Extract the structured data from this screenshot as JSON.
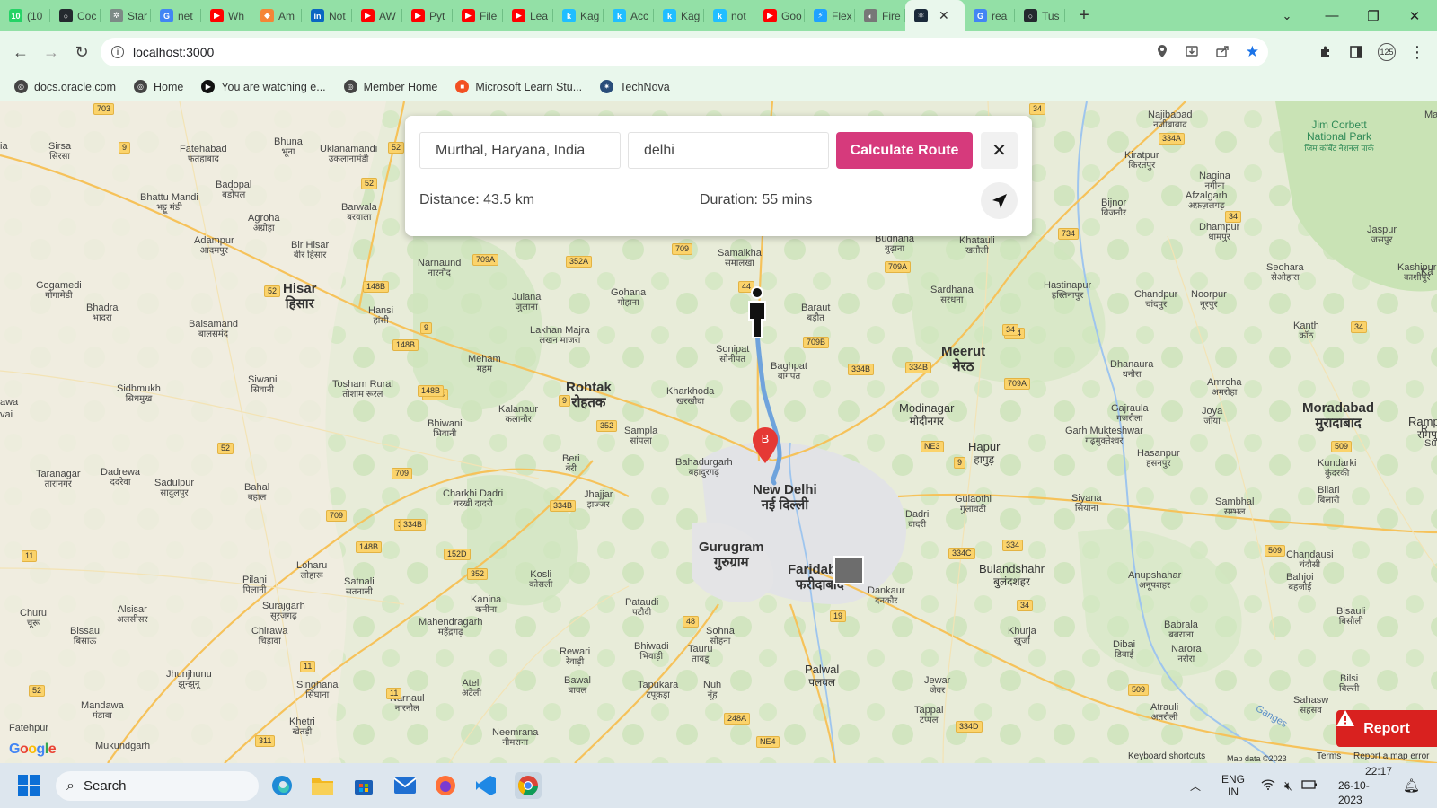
{
  "browser": {
    "tabs": [
      {
        "label": "(10",
        "icon": "whatsapp-icon",
        "color": "#25d366",
        "glyph": "10"
      },
      {
        "label": "Coc",
        "icon": "github-icon",
        "color": "#24292e",
        "glyph": "○"
      },
      {
        "label": "Star",
        "icon": "openai-icon",
        "color": "#7d8a86",
        "glyph": "✲"
      },
      {
        "label": "net",
        "icon": "google-icon",
        "color": "#4285f4",
        "glyph": "G"
      },
      {
        "label": "Wh",
        "icon": "youtube-icon",
        "color": "#ff0000",
        "glyph": "▶"
      },
      {
        "label": "Am",
        "icon": "aws-icon",
        "color": "#f58536",
        "glyph": "◆"
      },
      {
        "label": "Not",
        "icon": "linkedin-icon",
        "color": "#0a66c2",
        "glyph": "in"
      },
      {
        "label": "AW",
        "icon": "youtube-icon",
        "color": "#ff0000",
        "glyph": "▶"
      },
      {
        "label": "Pyt",
        "icon": "youtube-icon",
        "color": "#ff0000",
        "glyph": "▶"
      },
      {
        "label": "File",
        "icon": "youtube-icon",
        "color": "#ff0000",
        "glyph": "▶"
      },
      {
        "label": "Lea",
        "icon": "youtube-icon",
        "color": "#ff0000",
        "glyph": "▶"
      },
      {
        "label": "Kag",
        "icon": "kaggle-icon",
        "color": "#20beff",
        "glyph": "k"
      },
      {
        "label": "Acc",
        "icon": "kaggle-icon",
        "color": "#20beff",
        "glyph": "k"
      },
      {
        "label": "Kag",
        "icon": "kaggle-icon",
        "color": "#20beff",
        "glyph": "k"
      },
      {
        "label": "not",
        "icon": "kaggle-icon",
        "color": "#20beff",
        "glyph": "k"
      },
      {
        "label": "Goo",
        "icon": "youtube-icon",
        "color": "#ff0000",
        "glyph": "▶"
      },
      {
        "label": "Flex",
        "icon": "bolt-icon",
        "color": "#1fa2ff",
        "glyph": "⚡"
      },
      {
        "label": "Fire",
        "icon": "globe-icon",
        "color": "#777777",
        "glyph": "◐"
      },
      {
        "label": "",
        "icon": "react-icon",
        "color": "#1b2a3a",
        "glyph": "⚛",
        "active": true
      },
      {
        "label": "rea",
        "icon": "google-icon",
        "color": "#4285f4",
        "glyph": "G"
      },
      {
        "label": "Tus",
        "icon": "github-icon",
        "color": "#24292e",
        "glyph": "○"
      }
    ],
    "url": "localhost:3000",
    "bookmarks": [
      {
        "label": "docs.oracle.com",
        "icon": "globe-icon"
      },
      {
        "label": "Home",
        "icon": "globe-icon"
      },
      {
        "label": "You are watching e...",
        "icon": "play-icon"
      },
      {
        "label": "Member Home",
        "icon": "globe-icon"
      },
      {
        "label": "Microsoft Learn Stu...",
        "icon": "microsoft-icon"
      },
      {
        "label": "TechNova",
        "icon": "technova-icon"
      }
    ],
    "profile_badge": "125"
  },
  "route_panel": {
    "origin_value": "Murthal, Haryana, India",
    "destination_value": "delhi",
    "calculate_label": "Calculate Route",
    "close_label": "✕",
    "distance_text": "Distance: 43.5 km",
    "duration_text": "Duration: 55 mins"
  },
  "map": {
    "places": [
      {
        "en": "Sirsa",
        "hi": "सिरसा"
      },
      {
        "en": "Fatehabad",
        "hi": "फतेहाबाद"
      },
      {
        "en": "Bhuna",
        "hi": "भूना"
      },
      {
        "en": "Uklanamandi",
        "hi": "उकलानामंडी"
      },
      {
        "en": "Bhattu Mandi",
        "hi": "भट्टू मंडी"
      },
      {
        "en": "Badopal",
        "hi": "बडोपल"
      },
      {
        "en": "Barwala",
        "hi": "बरवाला"
      },
      {
        "en": "Agroha",
        "hi": "अग्रोहा"
      },
      {
        "en": "Adampur",
        "hi": "आदमपुर"
      },
      {
        "en": "Bir Hisar",
        "hi": "बीर हिसार"
      },
      {
        "en": "Narnaund",
        "hi": "नारनौंद"
      },
      {
        "en": "Gogamedi",
        "hi": "गोगामेडी"
      },
      {
        "en": "Bhadra",
        "hi": "भादरा"
      },
      {
        "en": "Hisar",
        "hi": "हिसार"
      },
      {
        "en": "Hansi",
        "hi": "हांसी"
      },
      {
        "en": "Balsamand",
        "hi": "बालसमंद"
      },
      {
        "en": "Julana",
        "hi": "जुलाना"
      },
      {
        "en": "Gohana",
        "hi": "गोहाना"
      },
      {
        "en": "Lakhan Majra",
        "hi": "लखन माजरा"
      },
      {
        "en": "Samalkha",
        "hi": "समालखा"
      },
      {
        "en": "Budhana",
        "hi": "बुढ़ाना"
      },
      {
        "en": "Khatauli",
        "hi": "खतौली"
      },
      {
        "en": "Meham",
        "hi": "महम"
      },
      {
        "en": "Sonipat",
        "hi": "सोनीपत"
      },
      {
        "en": "Baraut",
        "hi": "बड़ौत"
      },
      {
        "en": "Sardhana",
        "hi": "सरधना"
      },
      {
        "en": "Hastinapur",
        "hi": "हस्तिनापुर"
      },
      {
        "en": "Sidhmukh",
        "hi": "सिधमुख"
      },
      {
        "en": "Siwani",
        "hi": "सिवानी"
      },
      {
        "en": "Tosham Rural",
        "hi": "तोशाम रूरल"
      },
      {
        "en": "Rohtak",
        "hi": "रोहतक"
      },
      {
        "en": "Kharkhoda",
        "hi": "खरखौदा"
      },
      {
        "en": "Baghpat",
        "hi": "बागपत"
      },
      {
        "en": "Meerut",
        "hi": "मेरठ"
      },
      {
        "en": "Modinagar",
        "hi": "मोदीनगर"
      },
      {
        "en": "Kalanaur",
        "hi": "कलानौर"
      },
      {
        "en": "Bhiwani",
        "hi": "भिवानी"
      },
      {
        "en": "Sampla",
        "hi": "सांपला"
      },
      {
        "en": "Hapur",
        "hi": "हापुड़"
      },
      {
        "en": "Bahadurgarh",
        "hi": "बहादुरगढ़"
      },
      {
        "en": "Beri",
        "hi": "बेरी"
      },
      {
        "en": "New Delhi",
        "hi": "नई दिल्ली"
      },
      {
        "en": "Taranagar",
        "hi": "तारानगर"
      },
      {
        "en": "Dadrewa",
        "hi": "ददरेवा"
      },
      {
        "en": "Sadulpur",
        "hi": "सादुलपुर"
      },
      {
        "en": "Bahal",
        "hi": "बहाल"
      },
      {
        "en": "Charkhi Dadri",
        "hi": "चरखी दादरी"
      },
      {
        "en": "Jhajjar",
        "hi": "झज्जर"
      },
      {
        "en": "Gulaothi",
        "hi": "गुलावठी"
      },
      {
        "en": "Dadri",
        "hi": "दादरी"
      },
      {
        "en": "Gurugram",
        "hi": "गुरुग्राम"
      },
      {
        "en": "Faridabad",
        "hi": "फरीदाबाद"
      },
      {
        "en": "Bulandshahr",
        "hi": "बुलंदशहर"
      },
      {
        "en": "Pilani",
        "hi": "पिलानी"
      },
      {
        "en": "Loharu",
        "hi": "लोहारू"
      },
      {
        "en": "Satnali",
        "hi": "सतनाली"
      },
      {
        "en": "Kosli",
        "hi": "कोसली"
      },
      {
        "en": "Churu",
        "hi": "चूरू"
      },
      {
        "en": "Alsisar",
        "hi": "अलसीसर"
      },
      {
        "en": "Surajgarh",
        "hi": "सूरजगढ़"
      },
      {
        "en": "Kanina",
        "hi": "कनीना"
      },
      {
        "en": "Pataudi",
        "hi": "पटौदी"
      },
      {
        "en": "Dankaur",
        "hi": "दनकौर"
      },
      {
        "en": "Bissau",
        "hi": "बिसाऊ"
      },
      {
        "en": "Chirawa",
        "hi": "चिड़ावा"
      },
      {
        "en": "Mahendragarh",
        "hi": "महेंद्रगढ़"
      },
      {
        "en": "Sohna",
        "hi": "सोहना"
      },
      {
        "en": "Khurja",
        "hi": "खुर्जा"
      },
      {
        "en": "Jhunjhunu",
        "hi": "झुन्झुनू"
      },
      {
        "en": "Rewari",
        "hi": "रेवाड़ी"
      },
      {
        "en": "Bhiwadi",
        "hi": "भिवाड़ी"
      },
      {
        "en": "Tauru",
        "hi": "तावडू"
      },
      {
        "en": "Palwal",
        "hi": "पलवल"
      },
      {
        "en": "Singhana",
        "hi": "सिंघाना"
      },
      {
        "en": "Ateli",
        "hi": "अटेली"
      },
      {
        "en": "Bawal",
        "hi": "बावल"
      },
      {
        "en": "Tapukara",
        "hi": "टपूकड़ा"
      },
      {
        "en": "Nuh",
        "hi": "नूंह"
      },
      {
        "en": "Jewar",
        "hi": "जेवर"
      },
      {
        "en": "Mandawa",
        "hi": "मंडावा"
      },
      {
        "en": "Narnaul",
        "hi": "नारनौल"
      },
      {
        "en": "Tappal",
        "hi": "टप्पल"
      },
      {
        "en": "Khetri",
        "hi": "खेतड़ी"
      },
      {
        "en": "Neemrana",
        "hi": "नीमराना"
      },
      {
        "en": "Fatehpur",
        "hi": ""
      },
      {
        "en": "Mukundgarh",
        "hi": ""
      },
      {
        "en": "Najibabad",
        "hi": "नजीबाबाद"
      },
      {
        "en": "Kiratpur",
        "hi": "किरतपुर"
      },
      {
        "en": "Nagina",
        "hi": "नगीना"
      },
      {
        "en": "Bijnor",
        "hi": "बिजनौर"
      },
      {
        "en": "Afzalgarh",
        "hi": "अफ़ज़लगढ़"
      },
      {
        "en": "Dhampur",
        "hi": "धामपुर"
      },
      {
        "en": "Jaspur",
        "hi": "जसपुर"
      },
      {
        "en": "Kashipur",
        "hi": "काशीपुर"
      },
      {
        "en": "Seohara",
        "hi": "सेओहारा"
      },
      {
        "en": "Chandpur",
        "hi": "चांदपुर"
      },
      {
        "en": "Noorpur",
        "hi": "नूरपुर"
      },
      {
        "en": "Kanth",
        "hi": "कॉठ"
      },
      {
        "en": "Dhanaura",
        "hi": "धनौरा"
      },
      {
        "en": "Amroha",
        "hi": "अमरोहा"
      },
      {
        "en": "Gajraula",
        "hi": "गजरौला"
      },
      {
        "en": "Joya",
        "hi": "जोया"
      },
      {
        "en": "Moradabad",
        "hi": "मुरादाबाद"
      },
      {
        "en": "Rampu",
        "hi": "रामपु"
      },
      {
        "en": "Garh Mukteshwar",
        "hi": "गढ़मुक्तेश्वर"
      },
      {
        "en": "Hasanpur",
        "hi": "हसनपुर"
      },
      {
        "en": "Kundarki",
        "hi": "कुंदरकी"
      },
      {
        "en": "Bilari",
        "hi": "बिलारी"
      },
      {
        "en": "Siyana",
        "hi": "सियाना"
      },
      {
        "en": "Sambhal",
        "hi": "सम्भल"
      },
      {
        "en": "Chandausi",
        "hi": "चंदौसी"
      },
      {
        "en": "Anupshahar",
        "hi": "अनूपशहर"
      },
      {
        "en": "Bahjoi",
        "hi": "बहजोई"
      },
      {
        "en": "Babrala",
        "hi": "बबराला"
      },
      {
        "en": "Bisauli",
        "hi": "बिसौली"
      },
      {
        "en": "Dibai",
        "hi": "डिबाई"
      },
      {
        "en": "Narora",
        "hi": "नरोरा"
      },
      {
        "en": "Bilsi",
        "hi": "बिल्सी"
      },
      {
        "en": "Sahasw",
        "hi": "सहसव"
      },
      {
        "en": "Atrauli",
        "hi": "अतरौली"
      }
    ],
    "edge_fragments": [
      "awa",
      "vai",
      "ia",
      "Ma",
      "R",
      "Su",
      "Ka"
    ],
    "highways": [
      "703",
      "9",
      "52",
      "52",
      "52",
      "709A",
      "352A",
      "709",
      "709A",
      "34",
      "334A",
      "34",
      "734",
      "34",
      "734",
      "148B",
      "148B",
      "9",
      "148B",
      "44",
      "709B",
      "334B",
      "334B",
      "34",
      "709A",
      "9",
      "352",
      "148B",
      "NE3",
      "9",
      "509",
      "52",
      "709",
      "334B",
      "709",
      "334B",
      "334B",
      "148B",
      "152D",
      "352",
      "48",
      "19",
      "334C",
      "334",
      "509",
      "52",
      "11",
      "11",
      "11",
      "248A",
      "NE4",
      "334D",
      "509",
      "34",
      "311"
    ],
    "park_label": "Jim Corbett National Park",
    "park_label_hi": "जिम कॉर्बेट नेशनल पार्क",
    "river_label": "Ganges",
    "marker_label": "B",
    "google_letters": [
      {
        "ch": "G",
        "color": "#4285f4"
      },
      {
        "ch": "o",
        "color": "#ea4335"
      },
      {
        "ch": "o",
        "color": "#fbbc05"
      },
      {
        "ch": "g",
        "color": "#4285f4"
      },
      {
        "ch": "l",
        "color": "#34a853"
      },
      {
        "ch": "e",
        "color": "#ea4335"
      }
    ],
    "attribution": [
      "Keyboard shortcuts",
      "Map data ©2023",
      "Terms",
      "Report a map error"
    ],
    "report_label": "Report"
  },
  "taskbar": {
    "search_placeholder": "Search",
    "lang_top": "ENG",
    "lang_bottom": "IN",
    "time": "22:17",
    "date": "26-10-2023"
  },
  "colors": {
    "accent_button": "#d63a7c",
    "route_line": "#6fa3dc",
    "marker": "#e53935",
    "report": "#d9211f"
  }
}
